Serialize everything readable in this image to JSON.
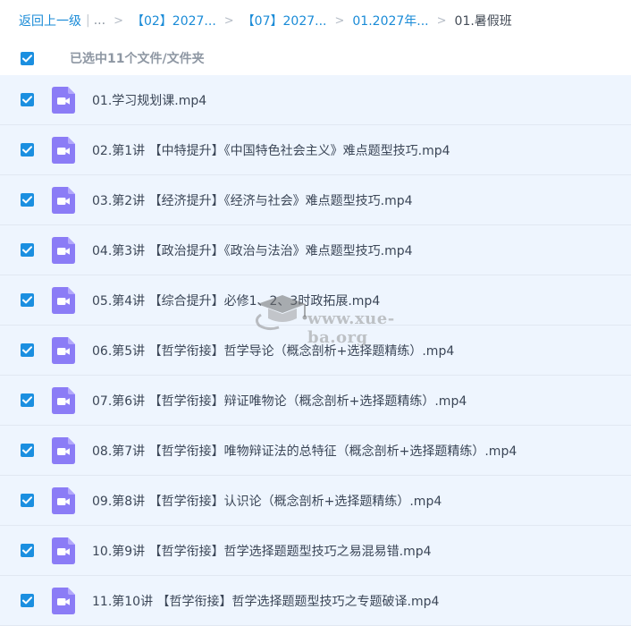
{
  "breadcrumb": {
    "back": "返回上一级",
    "bar": "|",
    "ellipsis": "...",
    "separator": ">",
    "crumbs": [
      "【02】2027...",
      "【07】2027...",
      "01.2027年..."
    ],
    "current": "01.暑假班"
  },
  "selection": {
    "label": "已选中11个文件/文件夹",
    "checked": true
  },
  "colors": {
    "accent": "#1b8fe0",
    "video_icon": "#8b7cf6",
    "row_selected": "#eef5fe"
  },
  "files": [
    {
      "name": "01.学习规划课.mp4",
      "icon": "video-file-icon",
      "checked": true
    },
    {
      "name": "02.第1讲 【中特提升】《中国特色社会主义》难点题型技巧.mp4",
      "icon": "video-file-icon",
      "checked": true
    },
    {
      "name": "03.第2讲 【经济提升】《经济与社会》难点题型技巧.mp4",
      "icon": "video-file-icon",
      "checked": true
    },
    {
      "name": "04.第3讲 【政治提升】《政治与法治》难点题型技巧.mp4",
      "icon": "video-file-icon",
      "checked": true
    },
    {
      "name": "05.第4讲 【综合提升】必修1、2、3时政拓展.mp4",
      "icon": "video-file-icon",
      "checked": true
    },
    {
      "name": "06.第5讲 【哲学衔接】哲学导论（概念剖析+选择题精练）.mp4",
      "icon": "video-file-icon",
      "checked": true
    },
    {
      "name": "07.第6讲 【哲学衔接】辩证唯物论（概念剖析+选择题精练）.mp4",
      "icon": "video-file-icon",
      "checked": true
    },
    {
      "name": "08.第7讲 【哲学衔接】唯物辩证法的总特征（概念剖析+选择题精练）.mp4",
      "icon": "video-file-icon",
      "checked": true
    },
    {
      "name": "09.第8讲 【哲学衔接】认识论（概念剖析+选择题精练）.mp4",
      "icon": "video-file-icon",
      "checked": true
    },
    {
      "name": "10.第9讲 【哲学衔接】哲学选择题题型技巧之易混易错.mp4",
      "icon": "video-file-icon",
      "checked": true
    },
    {
      "name": "11.第10讲 【哲学衔接】哲学选择题题型技巧之专题破译.mp4",
      "icon": "video-file-icon",
      "checked": true
    }
  ],
  "watermark": {
    "text": "www.xue-ba.org"
  }
}
